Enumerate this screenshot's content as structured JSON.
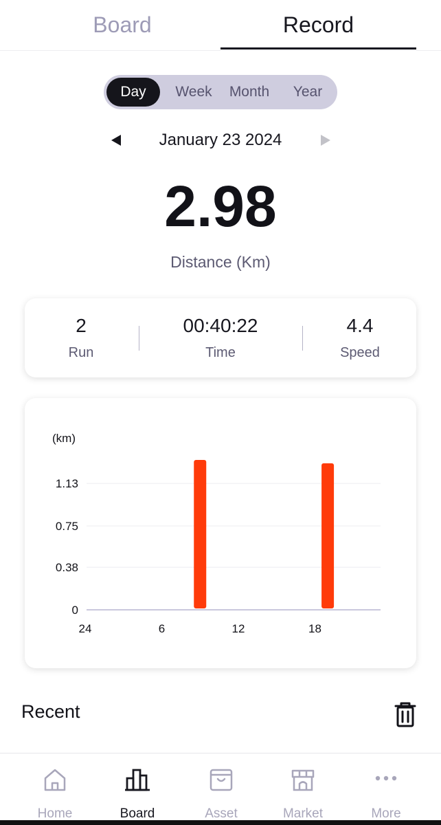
{
  "tabs": {
    "board": "Board",
    "record": "Record",
    "active": "Record"
  },
  "period": {
    "options": [
      "Day",
      "Week",
      "Month",
      "Year"
    ],
    "selected": "Day"
  },
  "date": {
    "label": "January 23 2024"
  },
  "summary": {
    "value": "2.98",
    "unit_label": "Distance (Km)"
  },
  "stats": {
    "run": {
      "value": "2",
      "label": "Run"
    },
    "time": {
      "value": "00:40:22",
      "label": "Time"
    },
    "speed": {
      "value": "4.4",
      "label": "Speed"
    }
  },
  "chart_data": {
    "type": "bar",
    "ylabel": "(km)",
    "yticks": [
      "0",
      "0.38",
      "0.75",
      "1.13"
    ],
    "xticks": [
      "24",
      "6",
      "12",
      "18"
    ],
    "ylim": [
      0,
      1.5
    ],
    "xlim": [
      0,
      24
    ],
    "x": [
      9,
      19
    ],
    "values": [
      1.34,
      1.31
    ],
    "bar_color": "#ff3b0a",
    "grid": true
  },
  "recent": {
    "title": "Recent"
  },
  "nav": [
    {
      "label": "Home",
      "icon": "home-icon",
      "active": false
    },
    {
      "label": "Board",
      "icon": "board-icon",
      "active": true
    },
    {
      "label": "Asset",
      "icon": "asset-icon",
      "active": false
    },
    {
      "label": "Market",
      "icon": "market-icon",
      "active": false
    },
    {
      "label": "More",
      "icon": "more-icon",
      "active": false
    }
  ],
  "colors": {
    "accent": "#ff3b0a",
    "active": "#17171f",
    "inactive": "#a8a6ba"
  }
}
